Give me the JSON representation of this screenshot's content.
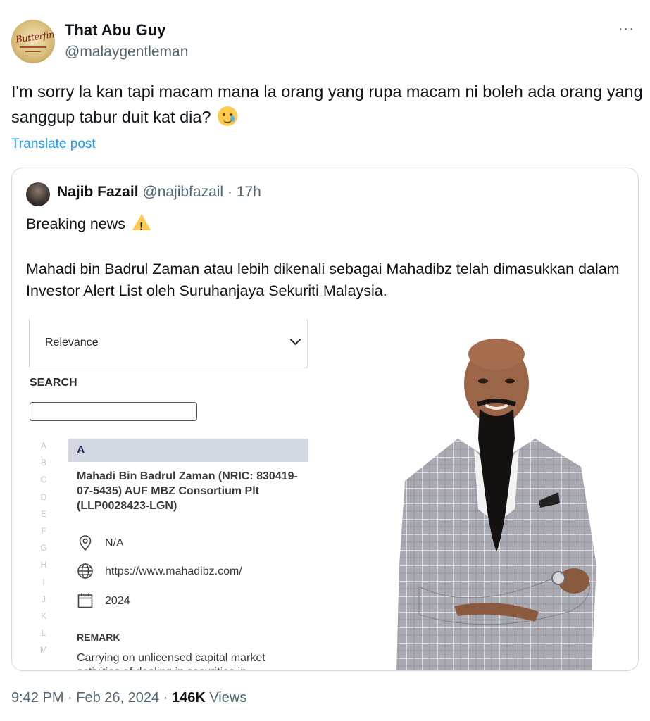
{
  "tweet": {
    "author_name": "That Abu Guy",
    "author_handle": "@malaygentleman",
    "avatar_text": "Butterfingers",
    "more_label": "···",
    "text": "I'm sorry la kan tapi macam mana la orang yang rupa macam ni boleh ada orang yang sanggup tabur duit kat dia?",
    "emoji": "face-holding-back-tears",
    "translate_label": "Translate post",
    "time": "9:42 PM",
    "date": "Feb 26, 2024",
    "views_count": "146K",
    "views_label": "Views"
  },
  "quote": {
    "author_name": "Najib Fazail",
    "author_handle": "@najibfazail",
    "time_ago": "17h",
    "line1": "Breaking news",
    "line2": "Mahadi bin Badrul Zaman atau lebih dikenali sebagai Mahadibz telah dimasukkan dalam Investor Alert List oleh Suruhanjaya Sekuriti Malaysia."
  },
  "media": {
    "sort_select": "Relevance",
    "search_heading": "SEARCH",
    "alphabet": [
      "A",
      "B",
      "C",
      "D",
      "E",
      "F",
      "G",
      "H",
      "I",
      "J",
      "K",
      "L",
      "M"
    ],
    "section_letter": "A",
    "entry_title": "Mahadi Bin Badrul Zaman (NRIC: 830419-07-5435) AUF MBZ Consortium Plt (LLP0028423-LGN)",
    "address": "N/A",
    "website": "https://www.mahadibz.com/",
    "year": "2024",
    "remark_heading": "REMARK",
    "remark_text": "Carrying on unlicensed capital market activities of dealing in securities in"
  },
  "colors": {
    "link": "#1d9bf0",
    "muted": "#536471",
    "border": "#cfd9de",
    "section_bar": "#d4d8e3"
  }
}
